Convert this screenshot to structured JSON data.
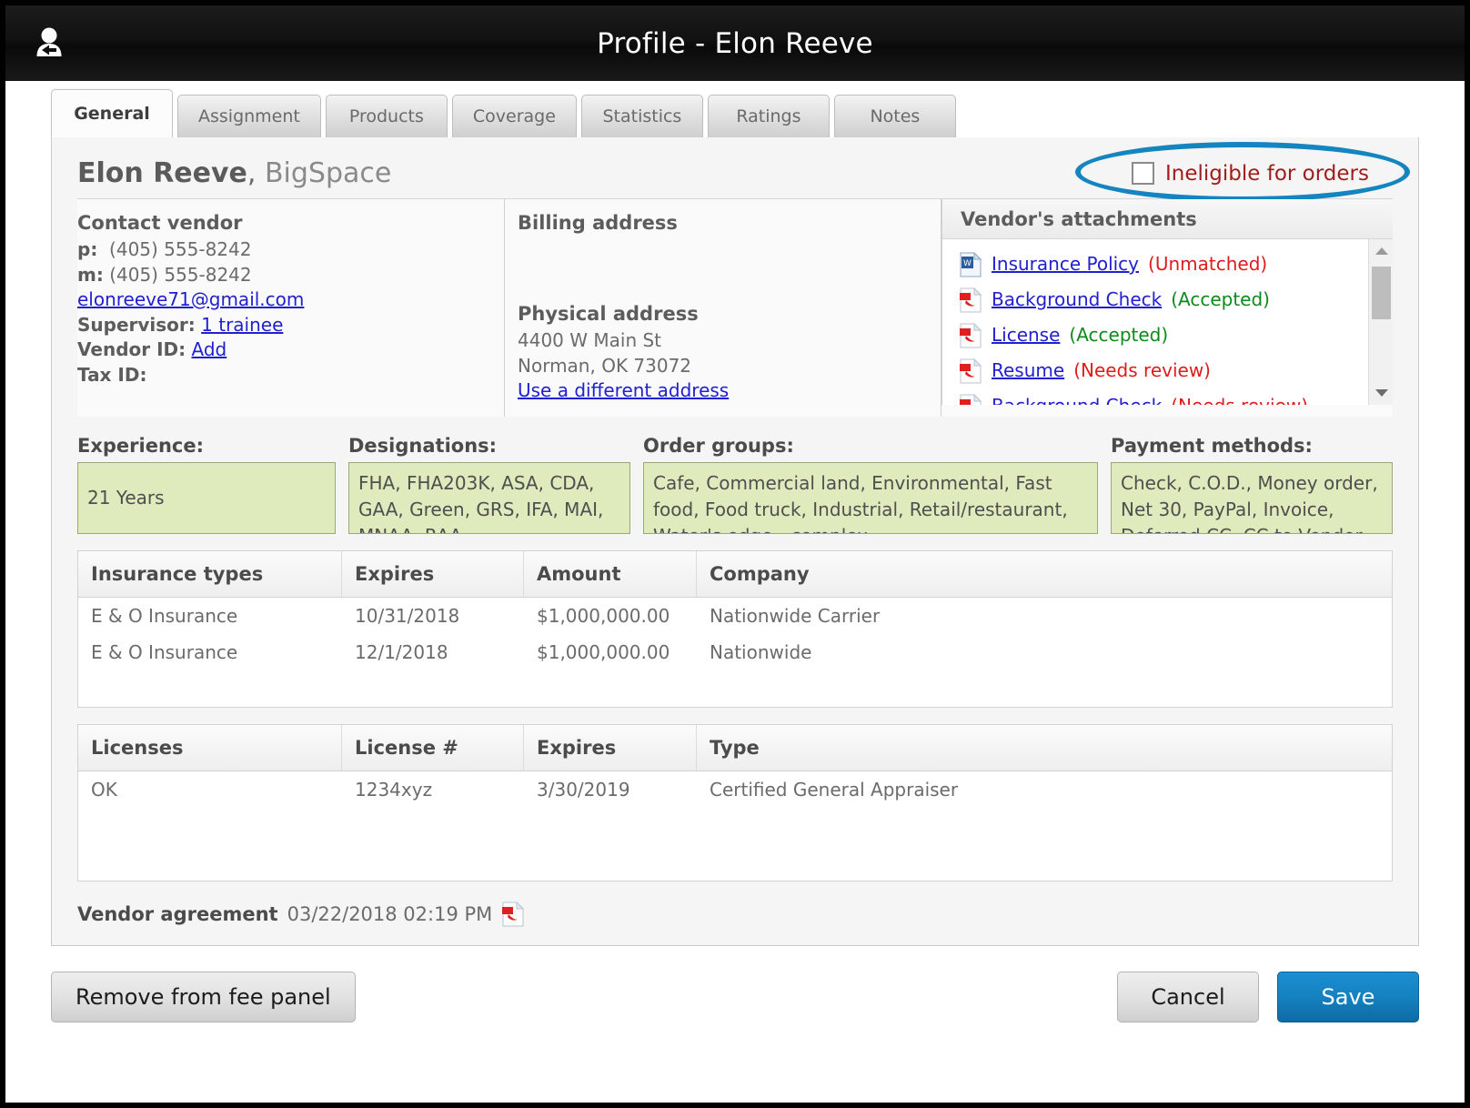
{
  "window": {
    "title": "Profile - Elon Reeve",
    "icon": "person-arrow-icon"
  },
  "tabs": [
    {
      "label": "General",
      "active": true
    },
    {
      "label": "Assignment",
      "active": false
    },
    {
      "label": "Products",
      "active": false
    },
    {
      "label": "Coverage",
      "active": false
    },
    {
      "label": "Statistics",
      "active": false
    },
    {
      "label": "Ratings",
      "active": false
    },
    {
      "label": "Notes",
      "active": false
    }
  ],
  "header": {
    "vendor_name": "Elon Reeve",
    "separator": ", ",
    "company": "BigSpace",
    "ineligible_label": "Ineligible for orders",
    "ineligible_checked": false,
    "highlight_color": "#1585c0",
    "ineligible_color": "#a01d1d"
  },
  "contact": {
    "title": "Contact vendor",
    "phone_label": "p:",
    "phone": "(405) 555-8242",
    "mobile_label": "m:",
    "mobile": "(405) 555-8242",
    "email": "elonreeve71@gmail.com",
    "supervisor_label": "Supervisor:",
    "supervisor_value": "1 trainee",
    "vendor_id_label": "Vendor ID:",
    "vendor_id_value": "Add",
    "tax_id_label": "Tax ID:",
    "tax_id_value": ""
  },
  "billing": {
    "title": "Billing address",
    "physical_title": "Physical address",
    "street": "4400 W Main St",
    "city_state_zip": "Norman, OK 73072",
    "different_address_link": "Use a different address"
  },
  "attachments": {
    "title": "Vendor's attachments",
    "items": [
      {
        "icon": "word-doc-icon",
        "name": "Insurance Policy",
        "status": "(Unmatched)",
        "status_type": "red"
      },
      {
        "icon": "pdf-doc-icon",
        "name": "Background Check",
        "status": "(Accepted)",
        "status_type": "green"
      },
      {
        "icon": "pdf-doc-icon",
        "name": "License",
        "status": "(Accepted)",
        "status_type": "green"
      },
      {
        "icon": "pdf-doc-icon",
        "name": "Resume",
        "status": "(Needs review)",
        "status_type": "red"
      },
      {
        "icon": "pdf-doc-icon",
        "name": "Background Check",
        "status": "(Needs review)",
        "status_type": "red"
      }
    ]
  },
  "fields": {
    "experience_title": "Experience:",
    "experience_value": "21 Years",
    "designations_title": "Designations:",
    "designations_value": "FHA, FHA203K, ASA, CDA, GAA, Green, GRS, IFA, MAI, MNAA, RAA,",
    "order_groups_title": "Order groups:",
    "order_groups_value": "Cafe, Commercial land, Environmental, Fast food, Food truck, Industrial, Retail/restaurant, Water's edge - complex",
    "payment_methods_title": "Payment methods:",
    "payment_methods_value": "Check, C.O.D., Money order, Net 30, PayPal, Invoice, Deferred CC, CC to Vendor",
    "box_color": "#dfeabd"
  },
  "insurance_table": {
    "columns": [
      "Insurance types",
      "Expires",
      "Amount",
      "Company"
    ],
    "rows": [
      [
        "E & O Insurance",
        "10/31/2018",
        "$1,000,000.00",
        "Nationwide Carrier"
      ],
      [
        "E & O Insurance",
        "12/1/2018",
        "$1,000,000.00",
        "Nationwide"
      ]
    ]
  },
  "licenses_table": {
    "columns": [
      "Licenses",
      "License #",
      "Expires",
      "Type"
    ],
    "rows": [
      [
        "OK",
        "1234xyz",
        "3/30/2019",
        "Certified General Appraiser"
      ]
    ]
  },
  "agreement": {
    "label": "Vendor agreement",
    "date": "03/22/2018 02:19 PM",
    "icon": "pdf-doc-icon"
  },
  "footer": {
    "remove_label": "Remove from fee panel",
    "cancel_label": "Cancel",
    "save_label": "Save",
    "save_color": "#1581c0"
  }
}
